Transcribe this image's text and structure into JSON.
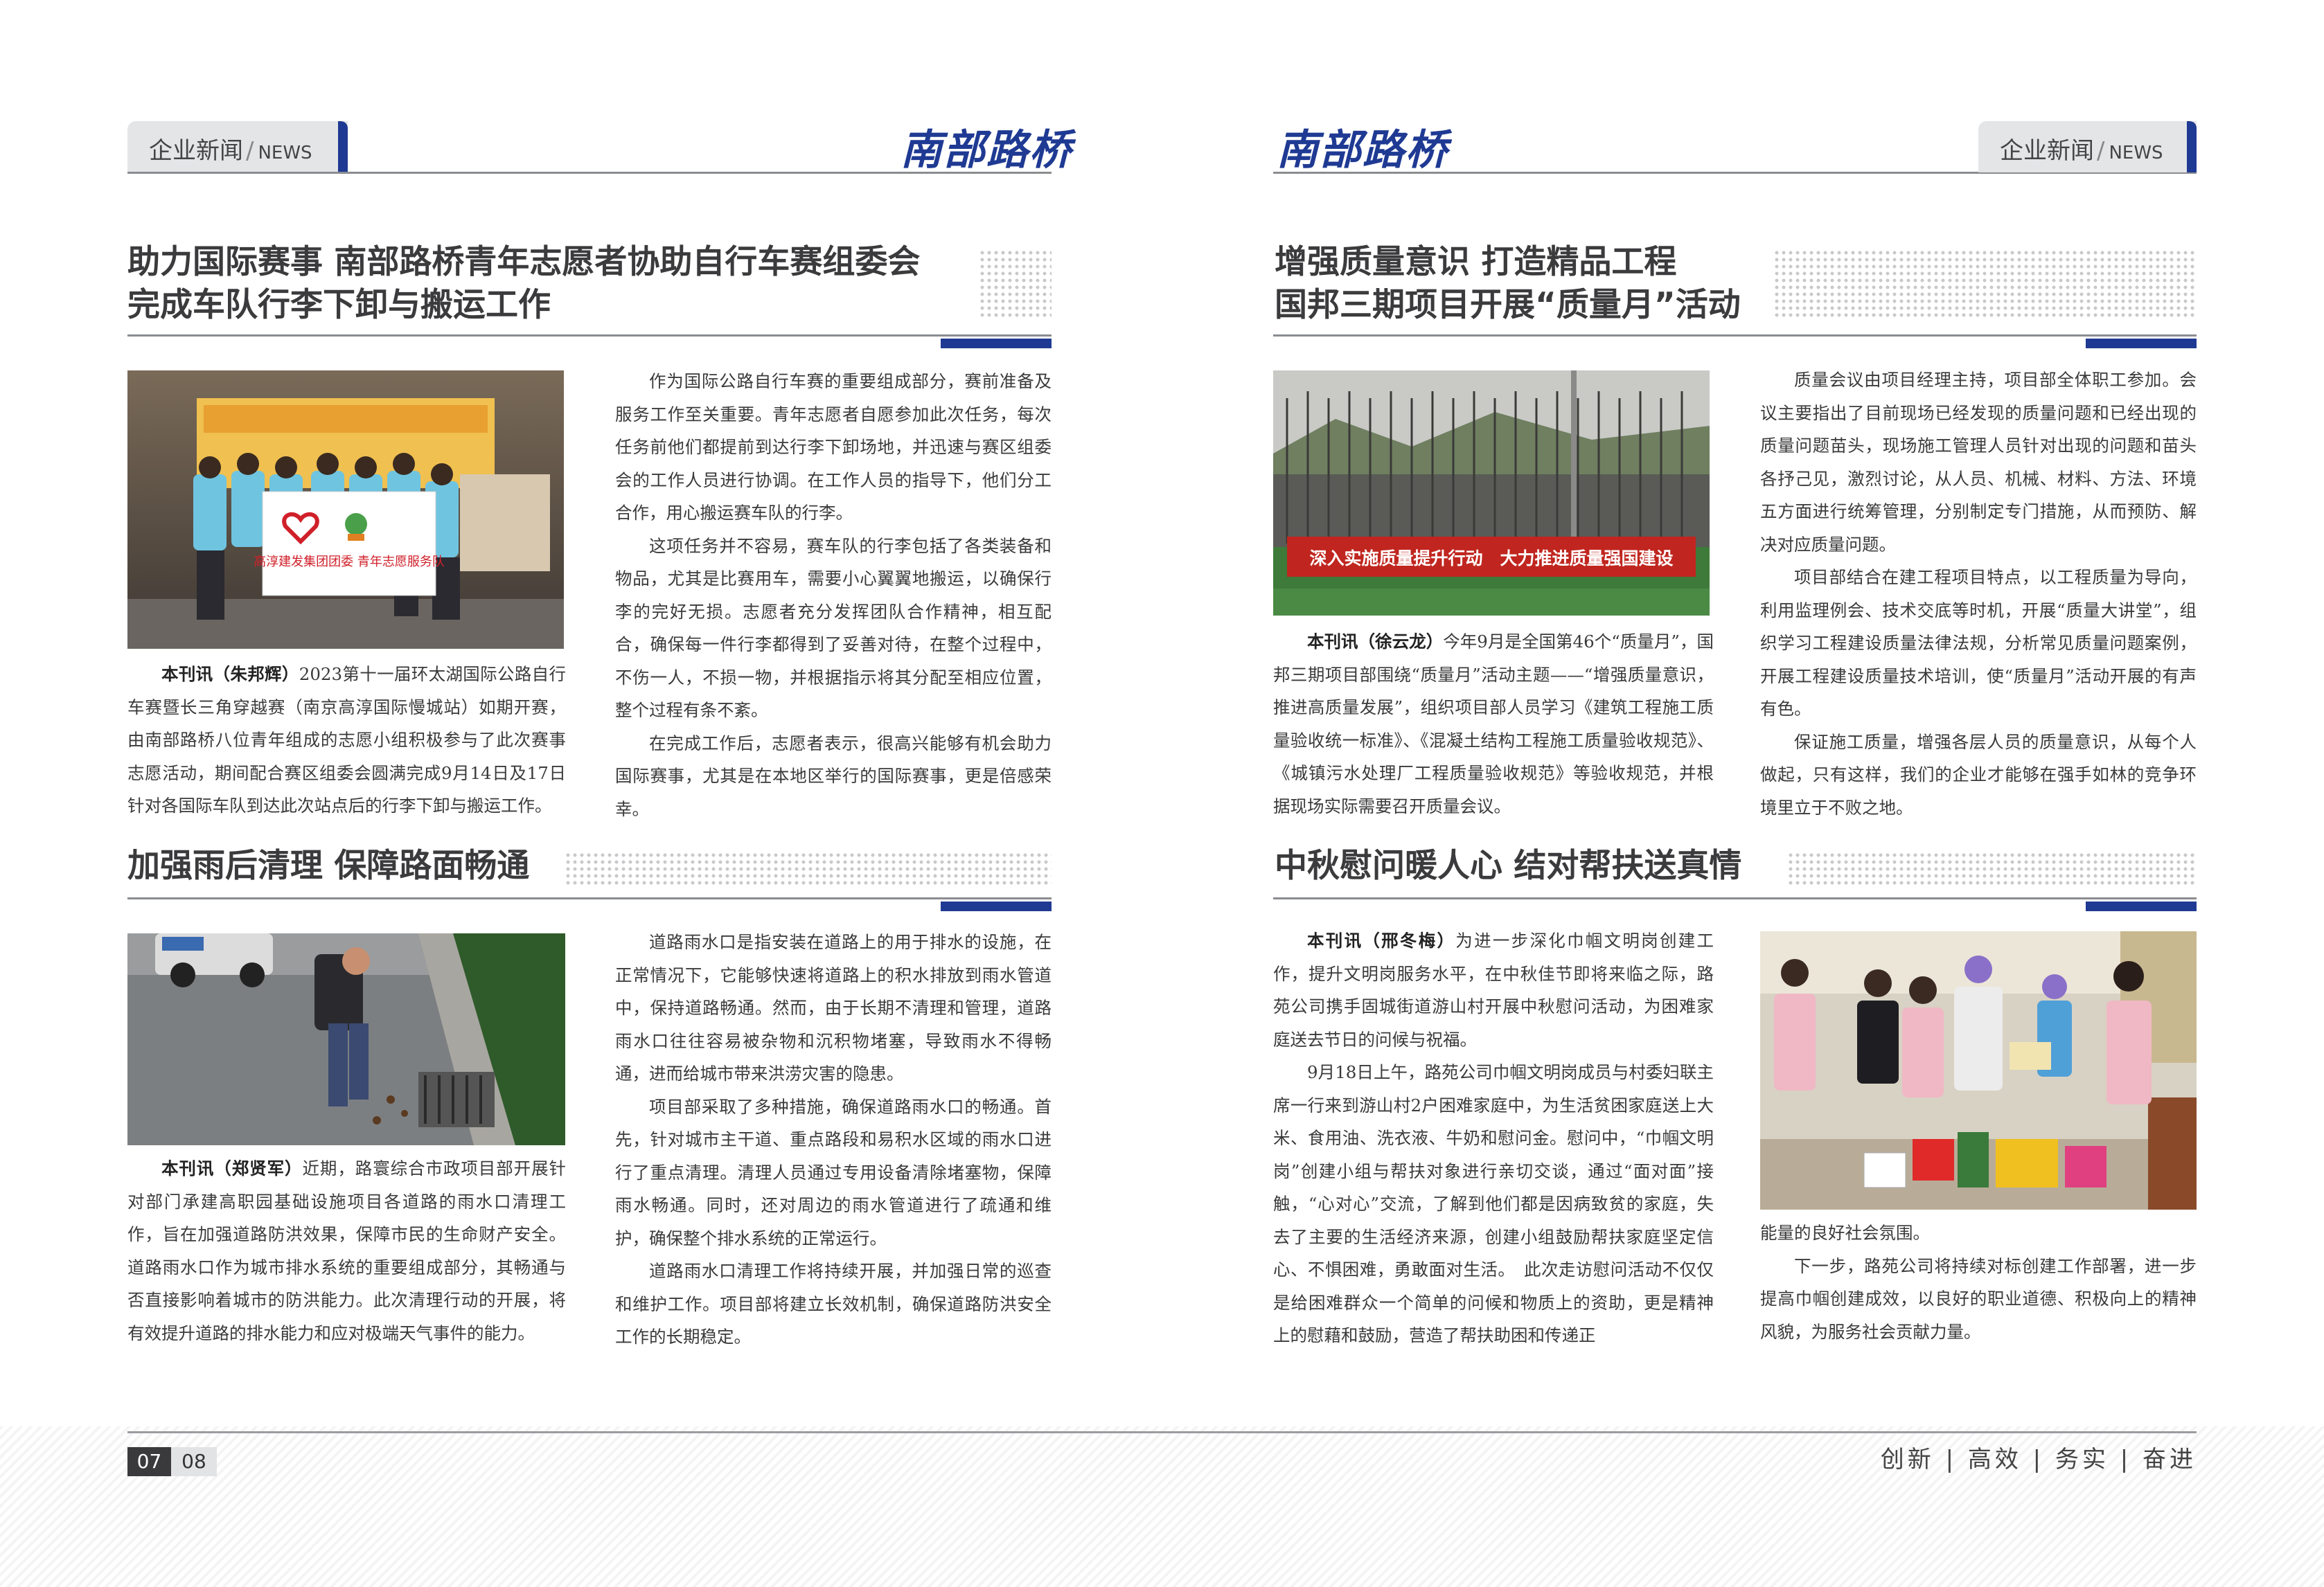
{
  "header": {
    "tag_cn": "企业新闻",
    "tag_sep": "/",
    "tag_en": "NEWS",
    "logo": "南部路桥"
  },
  "colors": {
    "accent": "#1f3a93",
    "grey_bar": "#e4e5e7",
    "banner_red": "#c0261f"
  },
  "article1": {
    "title_line1": "助力国际赛事 南部路桥青年志愿者协助自行车赛组委会",
    "title_line2": "完成车队行李下卸与搬运工作",
    "photo_banner": "高淳建发集团团委 青年志愿服务队",
    "lead": "本刊讯（朱邦辉）",
    "p1": "2023第十一届环太湖国际公路自行车赛暨长三角穿越赛（南京高淳国际慢城站）如期开赛，由南部路桥八位青年组成的志愿小组积极参与了此次赛事志愿活动，期间配合赛区组委会圆满完成9月14日及17日针对各国际车队到达此次站点后的行李下卸与搬运工作。",
    "p2": "作为国际公路自行车赛的重要组成部分，赛前准备及服务工作至关重要。青年志愿者自愿参加此次任务，每次任务前他们都提前到达行李下卸场地，并迅速与赛区组委会的工作人员进行协调。在工作人员的指导下，他们分工合作，用心搬运赛车队的行李。",
    "p3": "这项任务并不容易，赛车队的行李包括了各类装备和物品，尤其是比赛用车，需要小心翼翼地搬运，以确保行李的完好无损。志愿者充分发挥团队合作精神，相互配合，确保每一件行李都得到了妥善对待，在整个过程中，不伤一人，不损一物，并根据指示将其分配至相应位置，整个过程有条不紊。",
    "p4": "在完成工作后，志愿者表示，很高兴能够有机会助力国际赛事，尤其是在本地区举行的国际赛事，更是倍感荣幸。"
  },
  "article2": {
    "title": "加强雨后清理 保障路面畅通",
    "lead": "本刊讯（郑贤军）",
    "p1": "近期，路寰综合市政项目部开展针对部门承建高职园基础设施项目各道路的雨水口清理工作，旨在加强道路防洪效果，保障市民的生命财产安全。道路雨水口作为城市排水系统的重要组成部分，其畅通与否直接影响着城市的防洪能力。此次清理行动的开展，将有效提升道路的排水能力和应对极端天气事件的能力。",
    "p2": "道路雨水口是指安装在道路上的用于排水的设施，在正常情况下，它能够快速将道路上的积水排放到雨水管道中，保持道路畅通。然而，由于长期不清理和管理，道路雨水口往往容易被杂物和沉积物堵塞，导致雨水不得畅通，进而给城市带来洪涝灾害的隐患。",
    "p3": "项目部采取了多种措施，确保道路雨水口的畅通。首先，针对城市主干道、重点路段和易积水区域的雨水口进行了重点清理。清理人员通过专用设备清除堵塞物，保障雨水畅通。同时，还对周边的雨水管道进行了疏通和维护，确保整个排水系统的正常运行。",
    "p4": "道路雨水口清理工作将持续开展，并加强日常的巡查和维护工作。项目部将建立长效机制，确保道路防洪安全工作的长期稳定。"
  },
  "article3": {
    "title_line1": "增强质量意识 打造精品工程",
    "title_line2": "国邦三期项目开展“质量月”活动",
    "photo_banner": "深入实施质量提升行动　大力推进质量强国建设",
    "lead": "本刊讯（徐云龙）",
    "p1": "今年9月是全国第46个“质量月”，国邦三期项目部围绕“质量月”活动主题——“增强质量意识，推进高质量发展”，组织项目部人员学习《建筑工程施工质量验收统一标准》、《混凝土结构工程施工质量验收规范》、《城镇污水处理厂工程质量验收规范》等验收规范，并根据现场实际需要召开质量会议。",
    "p2": "质量会议由项目经理主持，项目部全体职工参加。会议主要指出了目前现场已经发现的质量问题和已经出现的质量问题苗头，现场施工管理人员针对出现的问题和苗头各抒己见，激烈讨论，从人员、机械、材料、方法、环境五方面进行统筹管理，分别制定专门措施，从而预防、解决对应质量问题。",
    "p3": "项目部结合在建工程项目特点，以工程质量为导向，利用监理例会、技术交底等时机，开展“质量大讲堂”，组织学习工程建设质量法律法规，分析常见质量问题案例，开展工程建设质量技术培训，使“质量月”活动开展的有声有色。",
    "p4": "保证施工质量，增强各层人员的质量意识，从每个人做起，只有这样，我们的企业才能够在强手如林的竞争环境里立于不败之地。"
  },
  "article4": {
    "title": "中秋慰问暖人心 结对帮扶送真情",
    "lead": "本刊讯（邢冬梅）",
    "p1": "为进一步深化巾帼文明岗创建工作，提升文明岗服务水平，在中秋佳节即将来临之际，路苑公司携手固城街道游山村开展中秋慰问活动，为困难家庭送去节日的问候与祝福。",
    "p2": "9月18日上午，路苑公司巾帼文明岗成员与村委妇联主席一行来到游山村2户困难家庭中，为生活贫困家庭送上大米、食用油、洗衣液、牛奶和慰问金。慰问中，“巾帼文明岗”创建小组与帮扶对象进行亲切交谈，通过“面对面”接触，“心对心”交流，了解到他们都是因病致贫的家庭，失去了主要的生活经济来源，创建小组鼓励帮扶家庭坚定信心、不惧困难，勇敢面对生活。　此次走访慰问活动不仅仅是给困难群众一个简单的问候和物质上的资助，更是精神上的慰藉和鼓励，营造了帮扶助困和传递正",
    "p3": "能量的良好社会氛围。",
    "p4": "下一步，路苑公司将持续对标创建工作部署，进一步提高巾帼创建成效，以良好的职业道德、积极向上的精神风貌，为服务社会贡献力量。"
  },
  "footer": {
    "page_left": "07",
    "page_right": "08",
    "slogan": "创新 | 高效 | 务实 | 奋进"
  }
}
